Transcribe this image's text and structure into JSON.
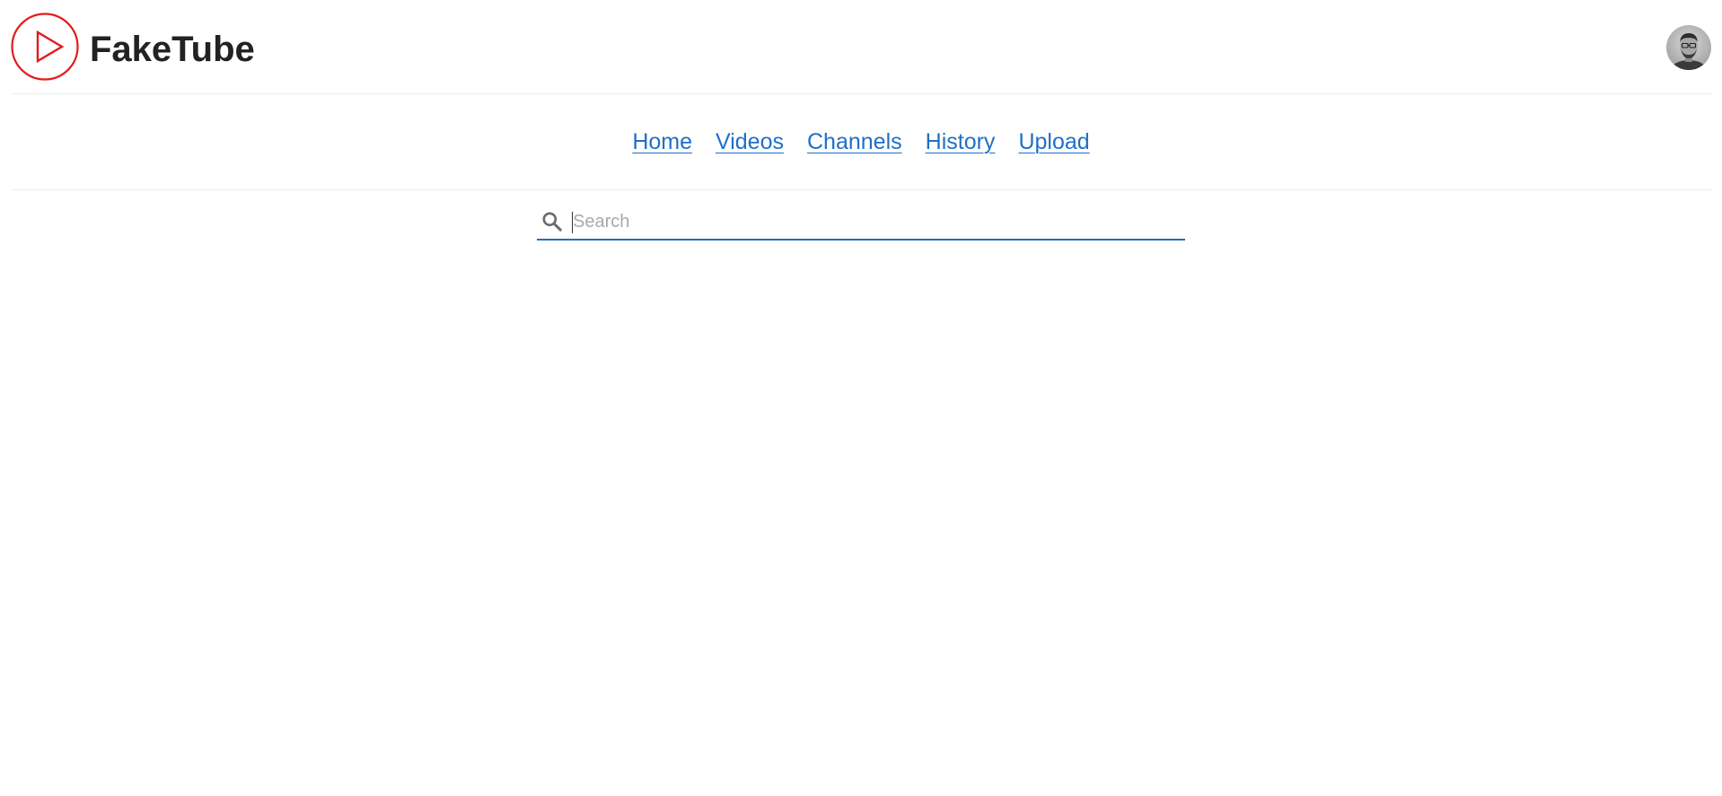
{
  "app": {
    "brand_name": "FakeTube",
    "logo_icon": "play-circle-icon",
    "brand_color": "#e31b1b"
  },
  "header": {
    "avatar_icon": "user-avatar"
  },
  "nav": {
    "items": [
      {
        "label": "Home"
      },
      {
        "label": "Videos"
      },
      {
        "label": "Channels"
      },
      {
        "label": "History"
      },
      {
        "label": "Upload"
      }
    ],
    "link_color": "#1f6fc8"
  },
  "search": {
    "placeholder": "Search",
    "value": "",
    "icon": "search-icon",
    "underline_color": "#1f6fc8"
  }
}
